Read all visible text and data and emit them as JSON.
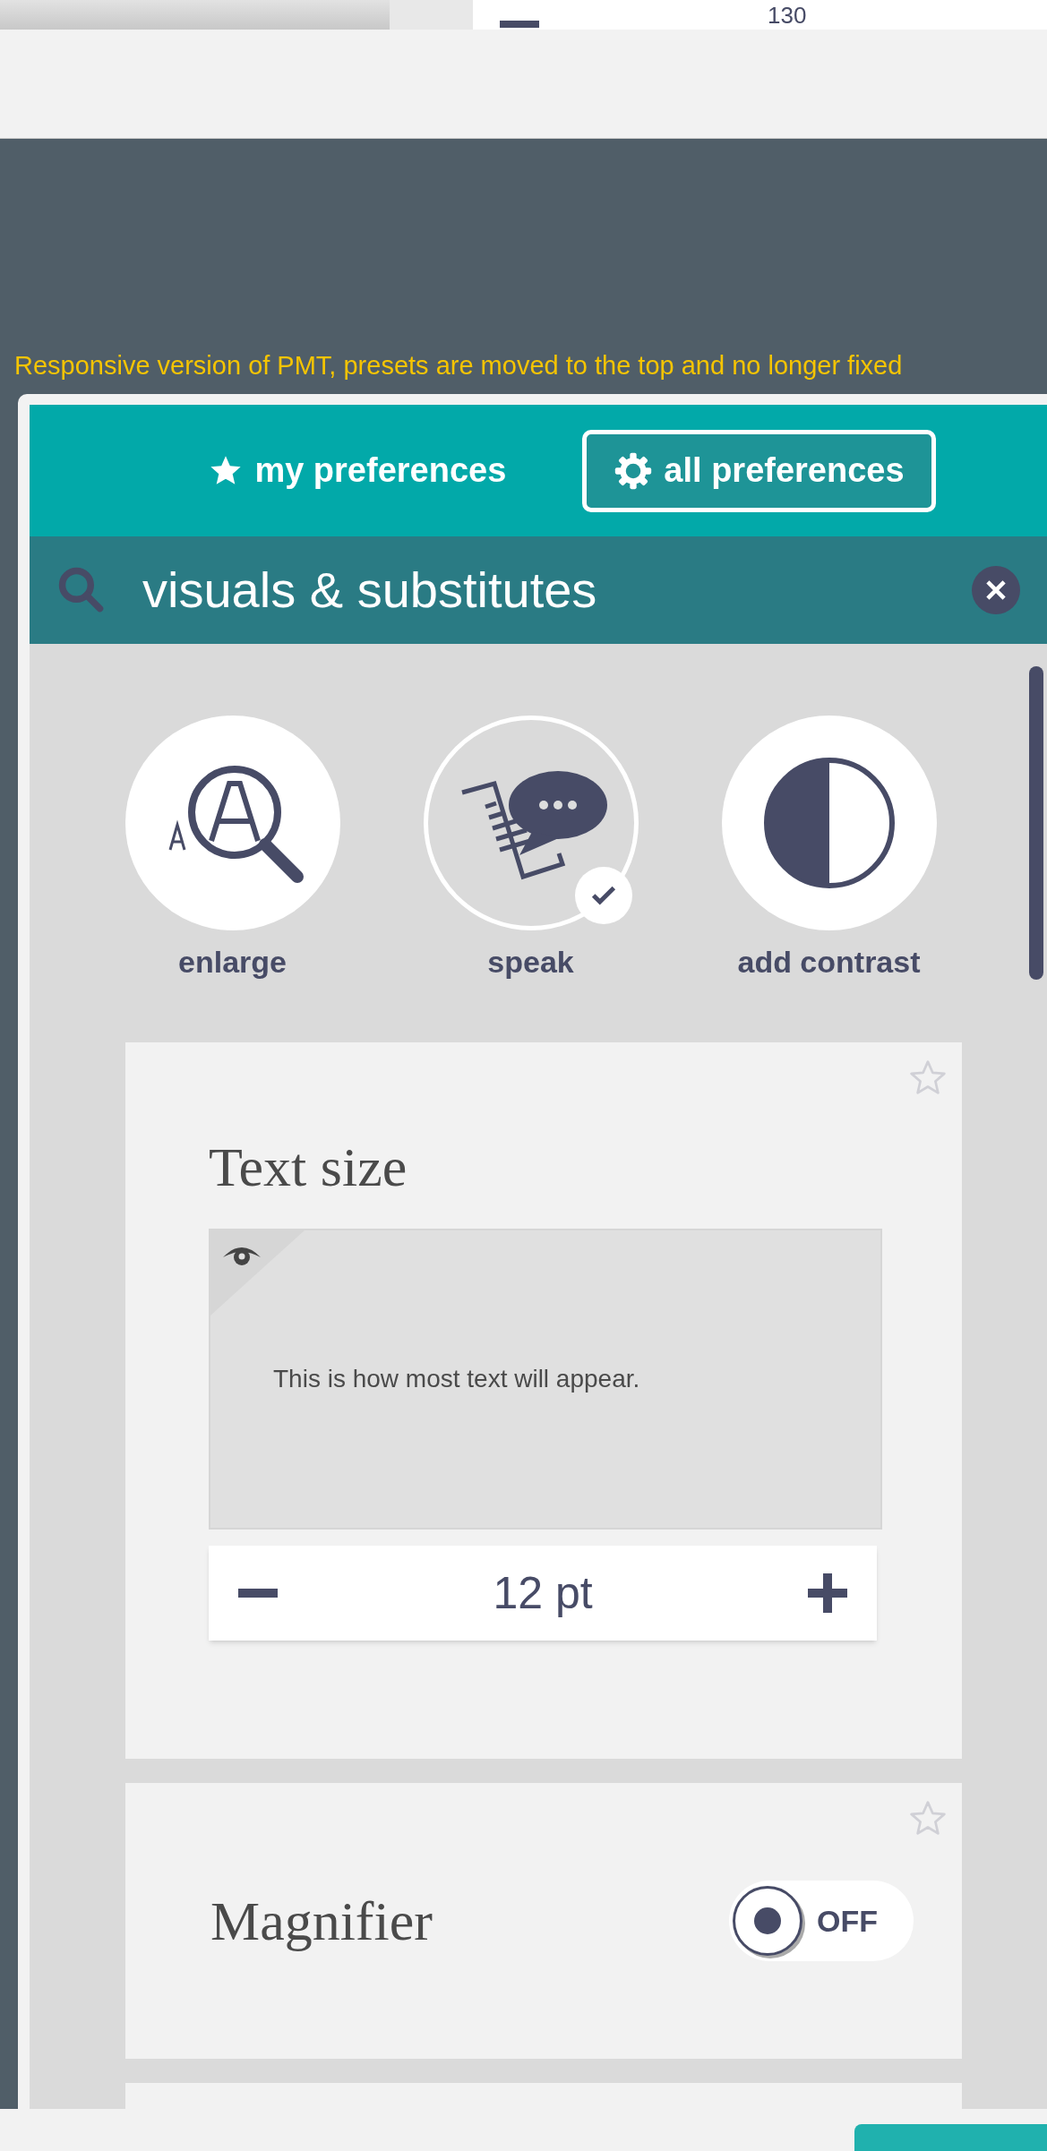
{
  "top_strip": {
    "value": "130"
  },
  "notice": "Responsive version of PMT, presets are moved to the top and no longer fixed",
  "tabs": [
    {
      "label": "my preferences",
      "kind": "star",
      "selected": false
    },
    {
      "label": "all preferences",
      "kind": "gear",
      "selected": true
    }
  ],
  "search": {
    "value": "visuals & substitutes"
  },
  "presets": [
    {
      "label": "enlarge",
      "kind": "enlarge",
      "selected": false
    },
    {
      "label": "speak",
      "kind": "speak",
      "selected": true
    },
    {
      "label": "add contrast",
      "kind": "contrast",
      "selected": false
    }
  ],
  "cards": [
    {
      "kind": "stepper",
      "title": "Text size",
      "favorite": false,
      "preview": "This is how most text will appear.",
      "value": "12 pt"
    },
    {
      "kind": "toggle",
      "title": "Magnifier",
      "favorite": false,
      "on": false,
      "state_label": "OFF"
    }
  ]
}
